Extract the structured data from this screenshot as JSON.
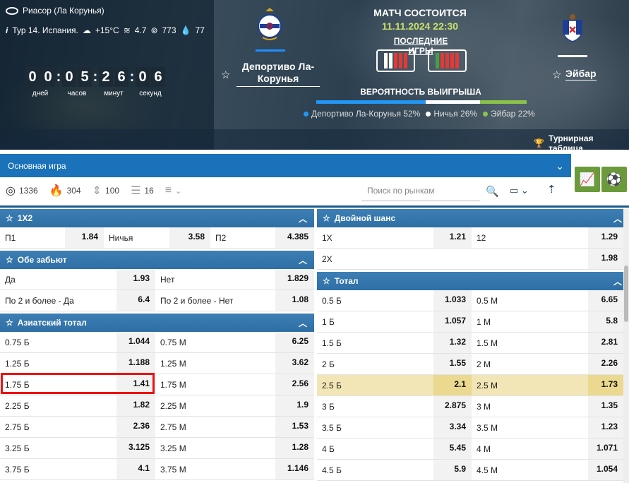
{
  "header": {
    "venue": "Риасор (Ла Корунья)",
    "round": "Тур 14. Испания.",
    "temperature": "+15°C",
    "wind": "4.7",
    "pressure": "773",
    "humidity": "77",
    "timer": {
      "days": [
        "0",
        "0"
      ],
      "hours": [
        "0",
        "5"
      ],
      "minutes": [
        "2",
        "6"
      ],
      "seconds": [
        "0",
        "6"
      ],
      "labels": {
        "days": "дней",
        "hours": "часов",
        "minutes": "минут",
        "seconds": "секунд"
      }
    },
    "home_team": "Депортиво Ла-Корунья",
    "away_team": "Эйбар",
    "match_status": "МАТЧ СОСТОИТСЯ",
    "match_date": "11.11.2024 22:30",
    "last_games_label": "ПОСЛЕДНИЕ ИГРЫ",
    "home_form": [
      "#ffffff",
      "#ffffff",
      "#e53935",
      "#e53935",
      "#e53935"
    ],
    "away_form": [
      "#43a047",
      "#e53935",
      "#e53935",
      "#e53935",
      "#e53935"
    ],
    "win_probability_title": "ВЕРОЯТНОСТЬ ВЫИГРЫША",
    "probabilities": [
      {
        "label": "Депортиво Ла-Корунья 52%",
        "value": 52,
        "color": "#2196f3"
      },
      {
        "label": "Ничья 26%",
        "value": 26,
        "color": "#ffffff"
      },
      {
        "label": "Эйбар 22%",
        "value": 22,
        "color": "#8bc34a"
      }
    ],
    "standings_label": "Турнирная таблица"
  },
  "game_select": {
    "value": "Основная игра"
  },
  "filters": [
    {
      "icon": "target-icon",
      "count": "1336"
    },
    {
      "icon": "fire-icon",
      "count": "304"
    },
    {
      "icon": "updown-icon",
      "count": "100"
    },
    {
      "icon": "bars-icon",
      "count": "16"
    }
  ],
  "search": {
    "placeholder": "Поиск по рынкам"
  },
  "markets_left": [
    {
      "title": "1X2",
      "rows": [
        {
          "cells": [
            [
              "П1",
              "1.84"
            ],
            [
              "Ничья",
              "3.58"
            ],
            [
              "П2",
              "4.385"
            ]
          ]
        }
      ]
    },
    {
      "title": "Обе забьют",
      "rows": [
        {
          "cells": [
            [
              "Да",
              "1.93"
            ],
            [
              "Нет",
              "1.829"
            ]
          ]
        },
        {
          "cells": [
            [
              "По 2 и более - Да",
              "6.4"
            ],
            [
              "По 2 и более - Нет",
              "1.08"
            ]
          ]
        }
      ]
    },
    {
      "title": "Азиатский тотал",
      "rows": [
        {
          "cells": [
            [
              "0.75 Б",
              "1.044"
            ],
            [
              "0.75 М",
              "6.25"
            ]
          ]
        },
        {
          "cells": [
            [
              "1.25 Б",
              "1.188"
            ],
            [
              "1.25 М",
              "3.62"
            ]
          ]
        },
        {
          "cells": [
            [
              "1.75 Б",
              "1.41"
            ],
            [
              "1.75 М",
              "2.56"
            ]
          ]
        },
        {
          "cells": [
            [
              "2.25 Б",
              "1.82"
            ],
            [
              "2.25 М",
              "1.9"
            ]
          ]
        },
        {
          "cells": [
            [
              "2.75 Б",
              "2.36"
            ],
            [
              "2.75 М",
              "1.53"
            ]
          ]
        },
        {
          "cells": [
            [
              "3.25 Б",
              "3.125"
            ],
            [
              "3.25 М",
              "1.28"
            ]
          ]
        },
        {
          "cells": [
            [
              "3.75 Б",
              "4.1"
            ],
            [
              "3.75 М",
              "1.146"
            ]
          ]
        }
      ]
    }
  ],
  "markets_right": [
    {
      "title": "Двойной шанс",
      "rows": [
        {
          "cells": [
            [
              "1X",
              "1.21"
            ],
            [
              "12",
              "1.29"
            ]
          ]
        },
        {
          "cells": [
            [
              "2X",
              ""
            ],
            [
              "",
              "1.98"
            ]
          ]
        }
      ]
    },
    {
      "title": "Тотал",
      "rows": [
        {
          "cells": [
            [
              "0.5 Б",
              "1.033"
            ],
            [
              "0.5 М",
              "6.65"
            ]
          ]
        },
        {
          "cells": [
            [
              "1 Б",
              "1.057"
            ],
            [
              "1 М",
              "5.8"
            ]
          ]
        },
        {
          "cells": [
            [
              "1.5 Б",
              "1.32"
            ],
            [
              "1.5 М",
              "2.81"
            ]
          ]
        },
        {
          "cells": [
            [
              "2 Б",
              "1.55"
            ],
            [
              "2 М",
              "2.26"
            ]
          ]
        },
        {
          "cells": [
            [
              "2.5 Б",
              "2.1"
            ],
            [
              "2.5 М",
              "1.73"
            ]
          ],
          "highlight": true
        },
        {
          "cells": [
            [
              "3 Б",
              "2.875"
            ],
            [
              "3 М",
              "1.35"
            ]
          ]
        },
        {
          "cells": [
            [
              "3.5 Б",
              "3.34"
            ],
            [
              "3.5 М",
              "1.23"
            ]
          ]
        },
        {
          "cells": [
            [
              "4 Б",
              "5.45"
            ],
            [
              "4 М",
              "1.071"
            ]
          ]
        },
        {
          "cells": [
            [
              "4.5 Б",
              "5.9"
            ],
            [
              "4.5 М",
              "1.054"
            ]
          ]
        }
      ]
    }
  ]
}
